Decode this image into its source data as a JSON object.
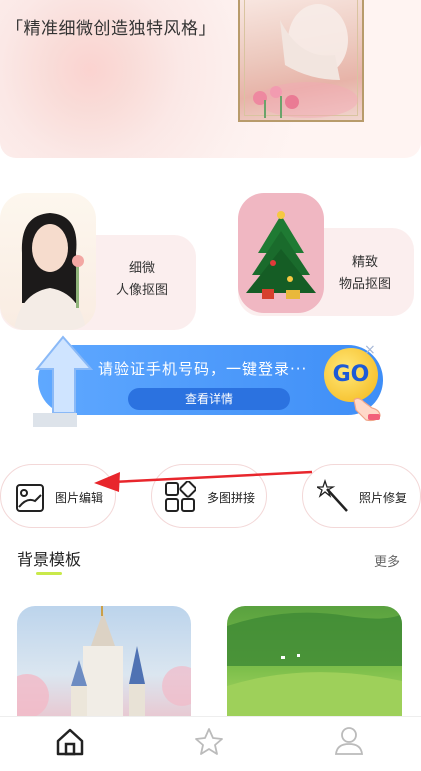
{
  "banner": {
    "title": "「精准细微创造独特风格」"
  },
  "features": [
    {
      "line1": "细微",
      "line2": "人像抠图"
    },
    {
      "line1": "精致",
      "line2": "物品抠图"
    }
  ],
  "ad": {
    "text": "请验证手机号码，一键登录···",
    "button": "查看详情",
    "go": "GO",
    "close": "×"
  },
  "tools": [
    {
      "label": "图片编辑",
      "icon": "image-edit-icon"
    },
    {
      "label": "多图拼接",
      "icon": "collage-icon"
    },
    {
      "label": "照片修复",
      "icon": "magic-wand-icon"
    }
  ],
  "section": {
    "title": "背景模板",
    "more": "更多"
  },
  "nav": [
    {
      "name": "home-icon",
      "active": true
    },
    {
      "name": "star-icon",
      "active": false
    },
    {
      "name": "user-icon",
      "active": false
    }
  ],
  "colors": {
    "accent": "#c9e94a",
    "ad_blue": "#3e8ef7",
    "arrow_red": "#e8262c"
  }
}
